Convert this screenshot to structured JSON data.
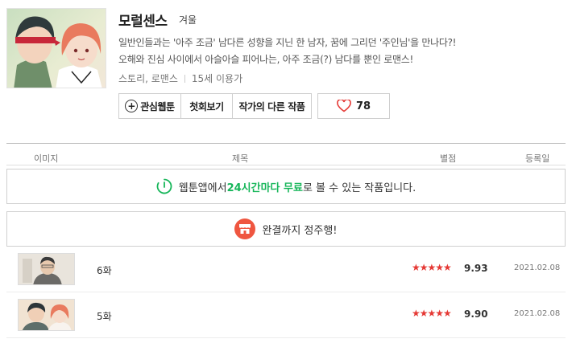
{
  "header": {
    "title": "모럴센스",
    "author": "겨울",
    "description_line1": "일반인들과는 '아주 조금' 남다른 성향을 지닌 한 남자, 꿈에 그리던 '주인님'을 만나다?!",
    "description_line2": "오해와 진심 사이에서 아슬아슬 피어나는, 아주 조금(?) 남다를 뿐인 로맨스!",
    "genre": "스토리, 로맨스",
    "age_rating": "15세 이용가"
  },
  "actions": {
    "favorite_label": "관심웹툰",
    "first_episode_label": "첫회보기",
    "other_works_label": "작가의 다른 작품",
    "like_count": "78"
  },
  "list_header": {
    "image": "이미지",
    "title": "제목",
    "rating": "별점",
    "date": "등록일"
  },
  "banners": {
    "app_prefix": "웹툰앱에서 ",
    "app_highlight": "24시간마다 무료",
    "app_suffix": "로 볼 수 있는 작품입니다.",
    "complete": "완결까지 정주행!"
  },
  "episodes": [
    {
      "title": "6화",
      "stars": "★★★★★",
      "score": "9.93",
      "date": "2021.02.08"
    },
    {
      "title": "5화",
      "stars": "★★★★★",
      "score": "9.90",
      "date": "2021.02.08"
    }
  ],
  "colors": {
    "accent_green": "#17b65a",
    "star_red": "#e53935",
    "heart_red": "#e53935",
    "store_icon": "#ef5640"
  }
}
